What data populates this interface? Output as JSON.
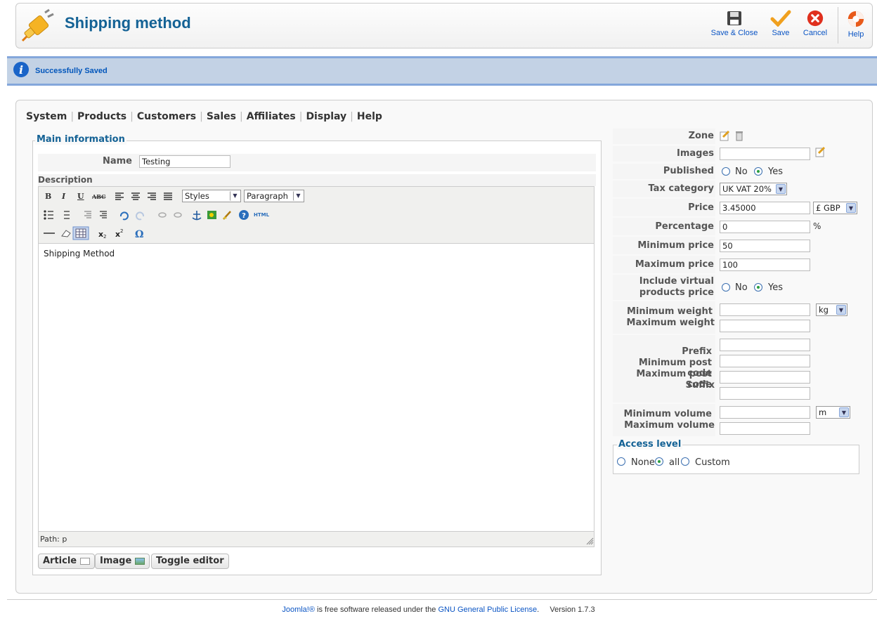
{
  "header": {
    "title": "Shipping method",
    "buttons": {
      "save_close": "Save & Close",
      "save": "Save",
      "cancel": "Cancel",
      "help": "Help"
    }
  },
  "message": "Successfully Saved",
  "menu": [
    "System",
    "Products",
    "Customers",
    "Sales",
    "Affiliates",
    "Display",
    "Help"
  ],
  "main_info": {
    "legend": "Main information",
    "name_label": "Name",
    "name_value": "Testing",
    "description_label": "Description",
    "editor": {
      "styles": "Styles",
      "format": "Paragraph",
      "content": "Shipping Method",
      "path": "Path: p",
      "html_icon": "HTML"
    },
    "buttons": {
      "article": "Article",
      "image": "Image",
      "toggle": "Toggle editor"
    }
  },
  "side": {
    "zone_label": "Zone",
    "images_label": "Images",
    "images_value": "",
    "published_label": "Published",
    "no": "No",
    "yes": "Yes",
    "published": "Yes",
    "tax_label": "Tax category",
    "tax_value": "UK VAT 20%",
    "price_label": "Price",
    "price_value": "3.45000",
    "currency": "£ GBP",
    "percentage_label": "Percentage",
    "percentage_value": "0",
    "percent_sign": "%",
    "min_price_label": "Minimum price",
    "min_price_value": "50",
    "max_price_label": "Maximum price",
    "max_price_value": "100",
    "include_virtual_label_1": "Include virtual",
    "include_virtual_label_2": "products price",
    "include_virtual": "Yes",
    "min_weight_label": "Minimum weight",
    "max_weight_label": "Maximum weight",
    "min_weight_value": "",
    "max_weight_value": "",
    "weight_unit": "kg",
    "prefix_label": "Prefix",
    "min_post_label": "Minimum post code",
    "max_post_label": "Maximum post code",
    "suffix_label": "Suffix",
    "min_volume_label": "Minimum volume",
    "max_volume_label": "Maximum volume",
    "volume_unit": "m"
  },
  "access": {
    "legend": "Access level",
    "options": [
      "None",
      "all",
      "Custom"
    ],
    "selected": "all"
  },
  "footer": {
    "joomla": "Joomla!®",
    "text1": " is free software released under the ",
    "license": "GNU General Public License",
    "text2": ".     Version 1.7.3"
  },
  "colors": {
    "title": "#146295",
    "link": "#0b55c4",
    "message_bg": "#c3d2e5",
    "cancel": "#e0301e",
    "save_check": "#f0a01e"
  }
}
